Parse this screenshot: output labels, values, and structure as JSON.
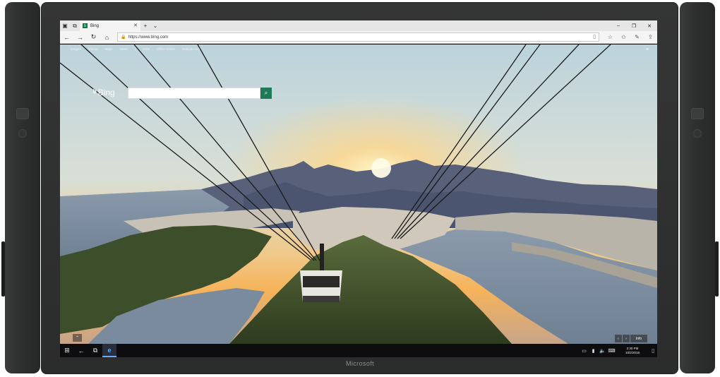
{
  "device": {
    "brand": "Microsoft"
  },
  "browser": {
    "tab_title": "Bing",
    "tab_favicon": "b",
    "new_tab": "+",
    "tab_list": "⌄",
    "url": "https://www.bing.com",
    "window_controls": [
      "–",
      "❐",
      "✕"
    ]
  },
  "page": {
    "nav_links": [
      "Images",
      "Videos",
      "Maps",
      "News",
      "|",
      "MSN",
      "Office Online",
      "Outlook.com"
    ],
    "logo_text": "Bing",
    "search_placeholder": "",
    "info_label": "Info"
  },
  "taskbar": {
    "time": "2:30 PM",
    "date": "10/2/2018"
  }
}
